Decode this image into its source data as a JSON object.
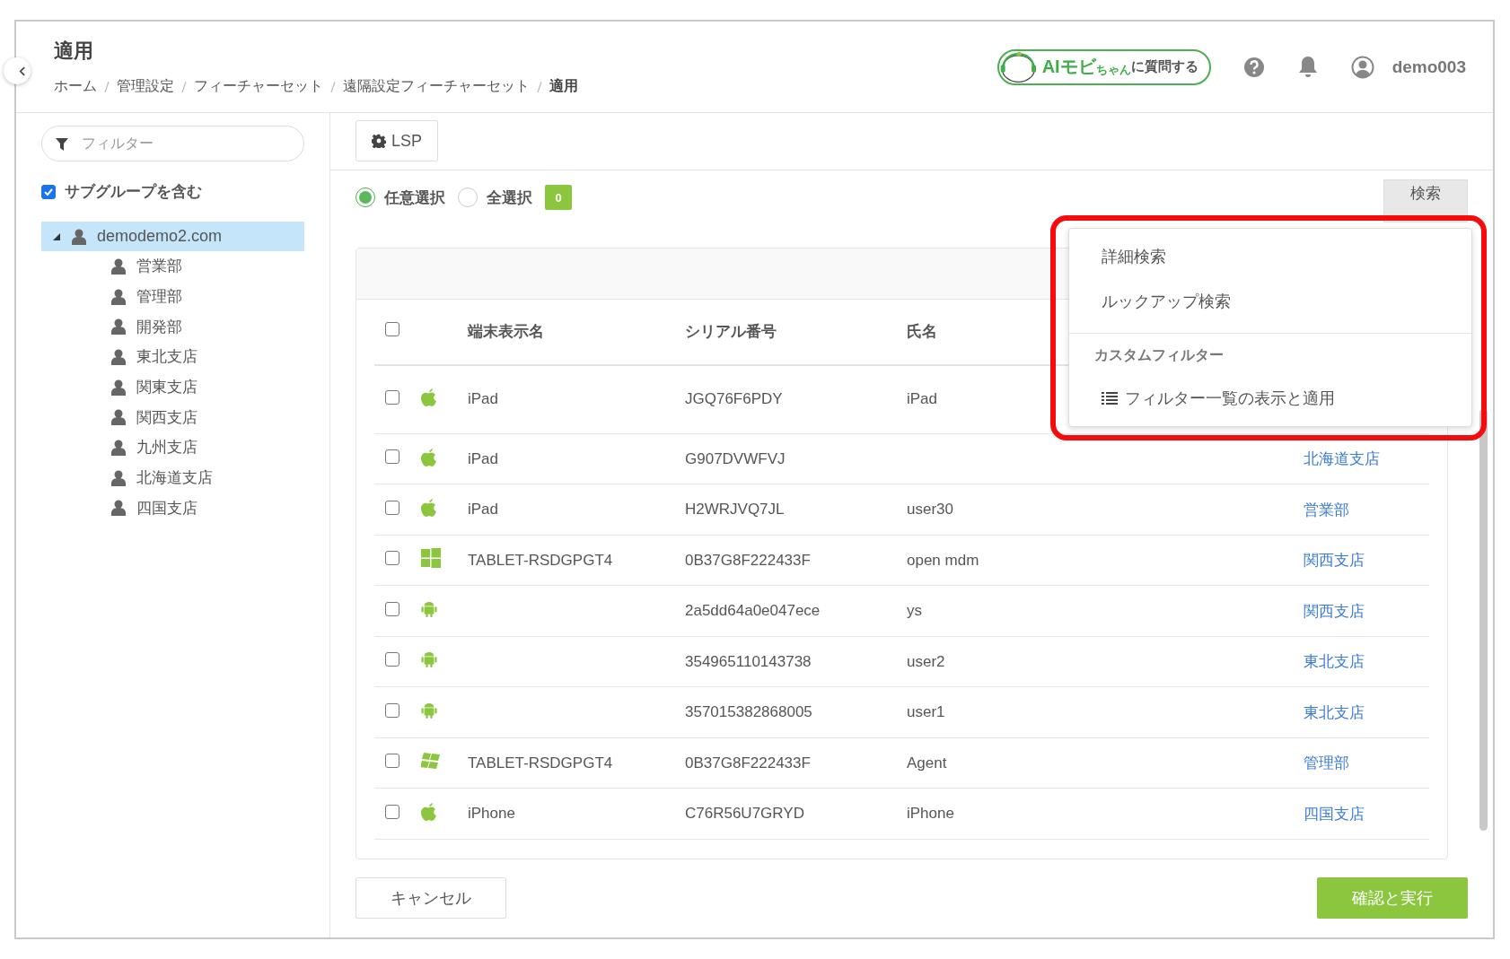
{
  "header": {
    "title": "適用",
    "breadcrumbs": [
      "ホーム",
      "管理設定",
      "フィーチャーセット",
      "遠隔設定フィーチャーセット",
      "適用"
    ],
    "ai_button": {
      "parts": [
        "AIモビ",
        "ちゃん",
        "に質問する"
      ]
    },
    "user": "demo003"
  },
  "sidebar": {
    "filter": {
      "placeholder": "フィルター"
    },
    "include_subgroups": {
      "label": "サブグループを含む",
      "checked": true
    },
    "tree": {
      "label": "demodemo2.com",
      "expanded": true,
      "selected": true,
      "children": [
        {
          "label": "営業部",
          "selected": false
        },
        {
          "label": "管理部",
          "selected": false
        },
        {
          "label": "開発部",
          "selected": false
        },
        {
          "label": "東北支店",
          "selected": false
        },
        {
          "label": "関東支店",
          "selected": false
        },
        {
          "label": "関西支店",
          "selected": false
        },
        {
          "label": "九州支店",
          "selected": false
        },
        {
          "label": "北海道支店",
          "selected": false
        },
        {
          "label": "四国支店",
          "selected": false
        }
      ]
    }
  },
  "feature_tab": {
    "label": "LSP"
  },
  "selection": {
    "radios": [
      {
        "label": "任意選択",
        "selected": true
      },
      {
        "label": "全選択",
        "selected": false
      }
    ],
    "count": "0",
    "search_button": "検索"
  },
  "table": {
    "all_checked": false,
    "columns": [
      "端末表示名",
      "シリアル番号",
      "氏名"
    ],
    "rows": [
      {
        "checked": false,
        "kind": "apple",
        "name": "iPad",
        "serial": "JGQ76F6PDY",
        "user": "iPad"
      },
      {
        "checked": false,
        "kind": "apple",
        "name": "iPad",
        "serial": "G907DVWFVJ",
        "group": "北海道支店"
      },
      {
        "checked": false,
        "kind": "apple",
        "name": "iPad",
        "serial": "H2WRJVQ7JL",
        "user": "user30",
        "group": "営業部"
      },
      {
        "checked": false,
        "kind": "windows",
        "name": "TABLET-RSDGPGT4",
        "serial": "0B37G8F222433F",
        "user": "open mdm",
        "group": "関西支店"
      },
      {
        "checked": false,
        "kind": "android",
        "serial": "2a5dd64a0e047ece",
        "user": "ys",
        "group": "関西支店"
      },
      {
        "checked": false,
        "kind": "android",
        "serial": "354965110143738",
        "user": "user2",
        "group": "東北支店"
      },
      {
        "checked": false,
        "kind": "android",
        "serial": "357015382868005",
        "user": "user1",
        "group": "東北支店"
      },
      {
        "checked": false,
        "kind": "legacy",
        "name": "TABLET-RSDGPGT4",
        "serial": "0B37G8F222433F",
        "user": "Agent",
        "group": "管理部"
      },
      {
        "checked": false,
        "kind": "apple",
        "name": "iPhone",
        "serial": "C76R56U7GRYD",
        "user": "iPhone",
        "group": "四国支店"
      }
    ]
  },
  "search_menu": {
    "items": [
      {
        "kind": "item",
        "label": "詳細検索"
      },
      {
        "kind": "item",
        "label": "ルックアップ検索"
      },
      {
        "kind": "header",
        "label": "カスタムフィルター"
      },
      {
        "kind": "list-item",
        "label": "フィルター一覧の表示と適用"
      }
    ]
  },
  "buttons": {
    "cancel": "キャンセル",
    "confirm": "確認と実行"
  }
}
